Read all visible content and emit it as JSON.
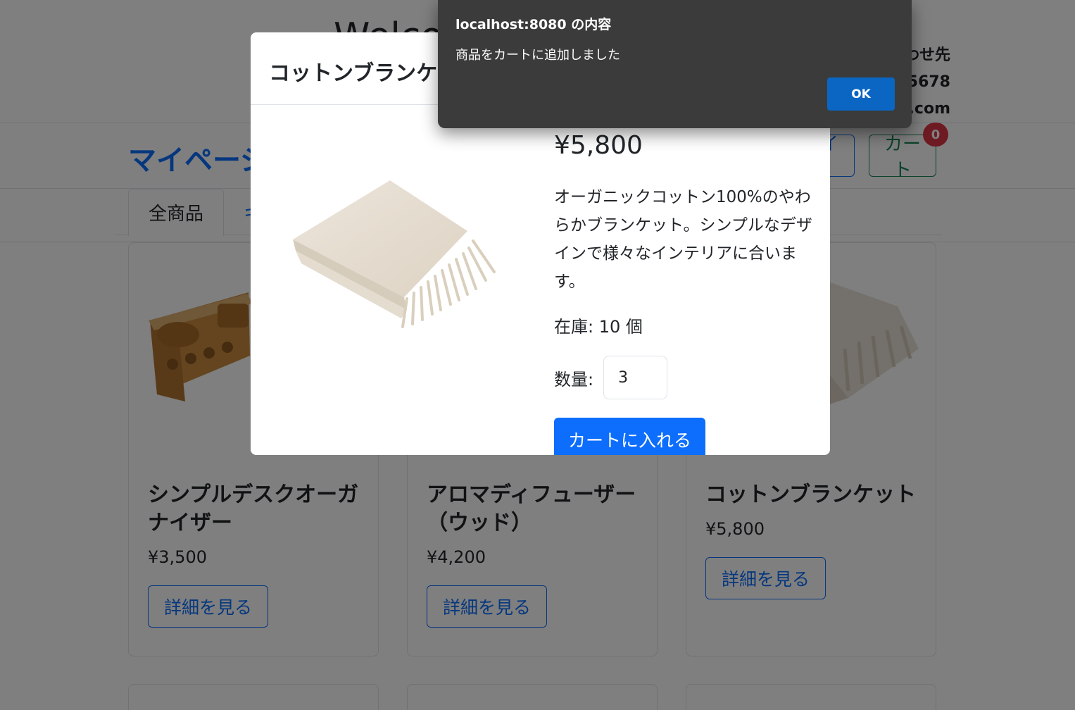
{
  "site": {
    "title": "Welcome",
    "contact_heading": "お問い合わせ先",
    "contact_phone": "03-1234-5678",
    "contact_email": "info@example.com"
  },
  "nav": {
    "brand": "マイページ",
    "login_label": "ログイント",
    "cart_label": "カート",
    "cart_count": "0"
  },
  "tabs": [
    {
      "label": "全商品"
    },
    {
      "label": "キッチン"
    }
  ],
  "products": [
    {
      "name": "シンプルデスクオーガナイザー",
      "price": "¥3,500",
      "button": "詳細を見る"
    },
    {
      "name": "アロマディフューザー（ウッド）",
      "price": "¥4,200",
      "button": "詳細を見る"
    },
    {
      "name": "コットンブランケット",
      "price": "¥5,800",
      "button": "詳細を見る"
    }
  ],
  "modal": {
    "title": "コットンブランケット",
    "price": "¥5,800",
    "description": "オーガニックコットン100%のやわらかブランケット。シンプルなデザインで様々なインテリアに合います。",
    "stock": "在庫: 10 個",
    "quantity_label": "数量:",
    "quantity_value": "3",
    "add_to_cart": "カートに入れる"
  },
  "alert": {
    "title": "localhost:8080 の内容",
    "message": "商品をカートに追加しました",
    "ok_label": "OK"
  },
  "colors": {
    "primary": "#0d6efd",
    "success": "#198754",
    "danger": "#dc3545",
    "alert_bg": "#3b3b3b",
    "alert_button": "#0a66c2"
  }
}
